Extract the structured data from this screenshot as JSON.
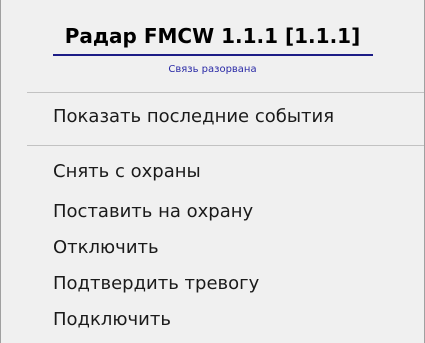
{
  "menu": {
    "title": "Радар FMCW 1.1.1 [1.1.1]",
    "status": "Связь разорвана",
    "items": [
      {
        "label": "Показать последние события"
      },
      {
        "label": "Снять с охраны"
      },
      {
        "label": "Поставить на охрану"
      },
      {
        "label": "Отключить"
      },
      {
        "label": "Подтвердить тревогу"
      },
      {
        "label": "Подключить"
      }
    ]
  },
  "colors": {
    "background": "#f0f0f0",
    "title_underline": "#1c1c86",
    "status_text": "#2a2aa6",
    "separator": "#c2c2c2"
  }
}
